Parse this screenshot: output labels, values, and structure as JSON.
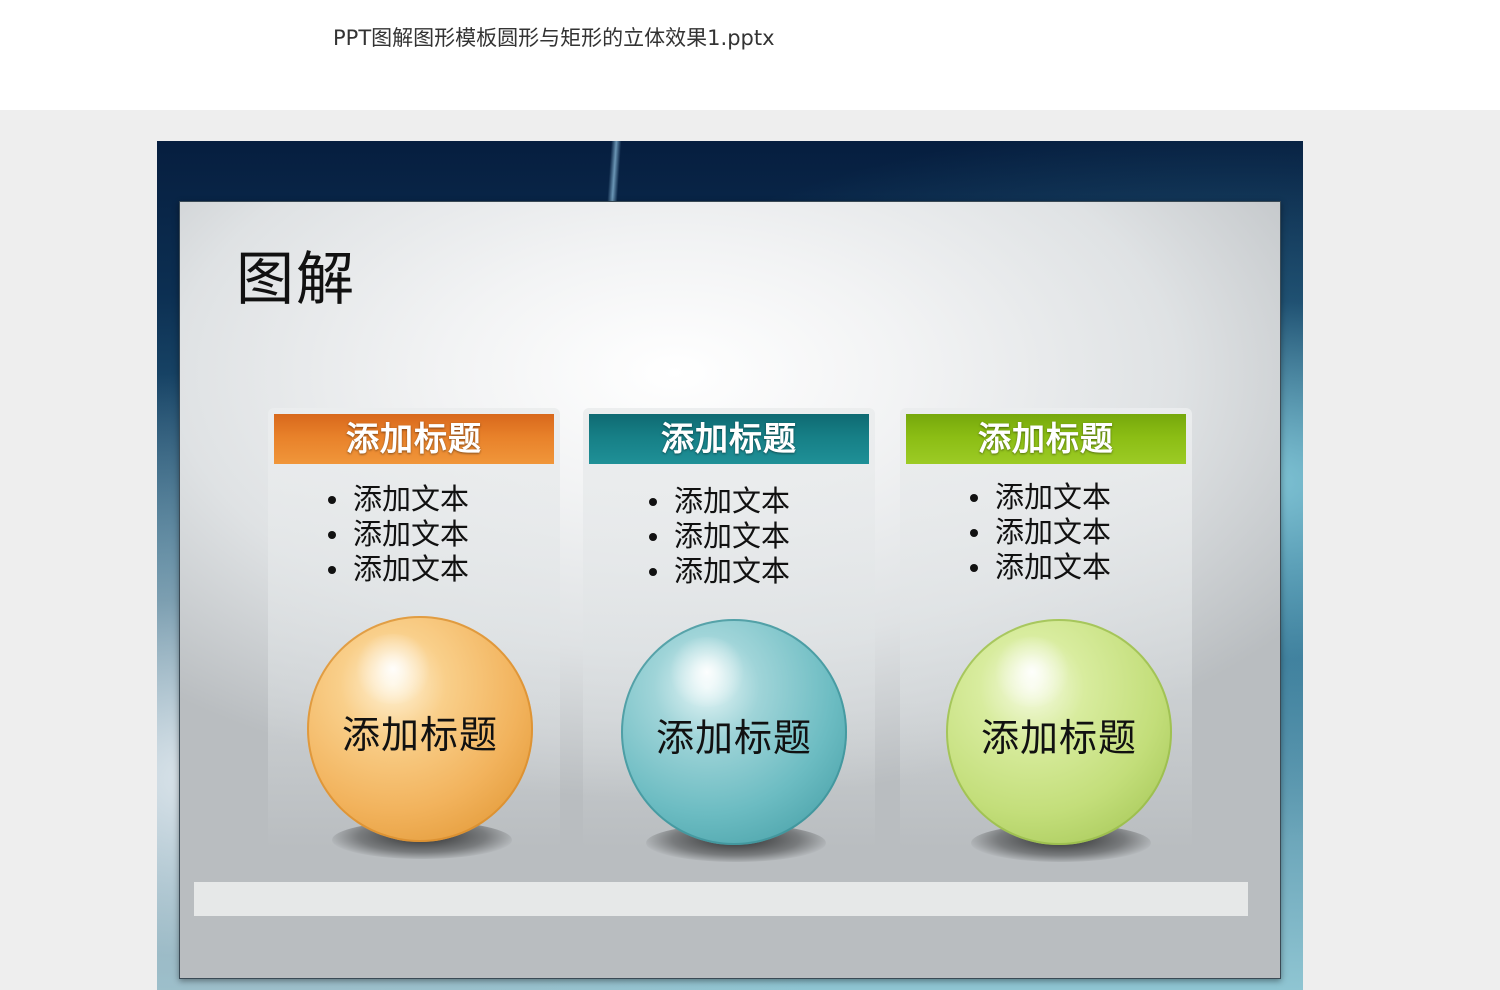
{
  "window": {
    "file_title": "PPT图解图形模板圆形与矩形的立体效果1.pptx"
  },
  "slide": {
    "title": "图解",
    "cards": [
      {
        "header": "添加标题",
        "header_color": "#e8812a",
        "bullets": [
          "添加文本",
          "添加文本",
          "添加文本"
        ],
        "ball_label": "添加标题",
        "ball_color": "#f5b968"
      },
      {
        "header": "添加标题",
        "header_color": "#167f86",
        "bullets": [
          "添加文本",
          "添加文本",
          "添加文本"
        ],
        "ball_label": "添加标题",
        "ball_color": "#6cbcc2"
      },
      {
        "header": "添加标题",
        "header_color": "#8bbd14",
        "bullets": [
          "添加文本",
          "添加文本",
          "添加文本"
        ],
        "ball_label": "添加标题",
        "ball_color": "#c3de7a"
      }
    ]
  }
}
